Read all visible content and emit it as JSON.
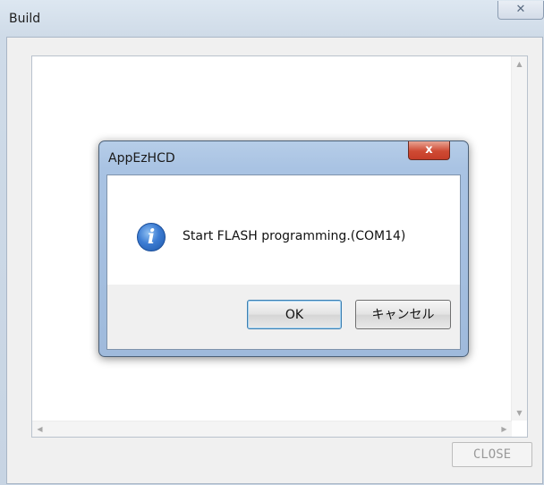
{
  "window": {
    "title": "Build",
    "close_glyph": "✕"
  },
  "output": {
    "text": ""
  },
  "close_button": {
    "label": "CLOSE"
  },
  "dialog": {
    "title": "AppEzHCD",
    "close_glyph": "x",
    "icon": "info-icon",
    "icon_glyph": "i",
    "message": "Start FLASH programming.(COM14)",
    "ok_label": "OK",
    "cancel_label": "キャンセル"
  },
  "colors": {
    "dialog_frame": "#a9c3e3",
    "close_red": "#c53d28",
    "outer_frame": "#cfdbe8"
  }
}
